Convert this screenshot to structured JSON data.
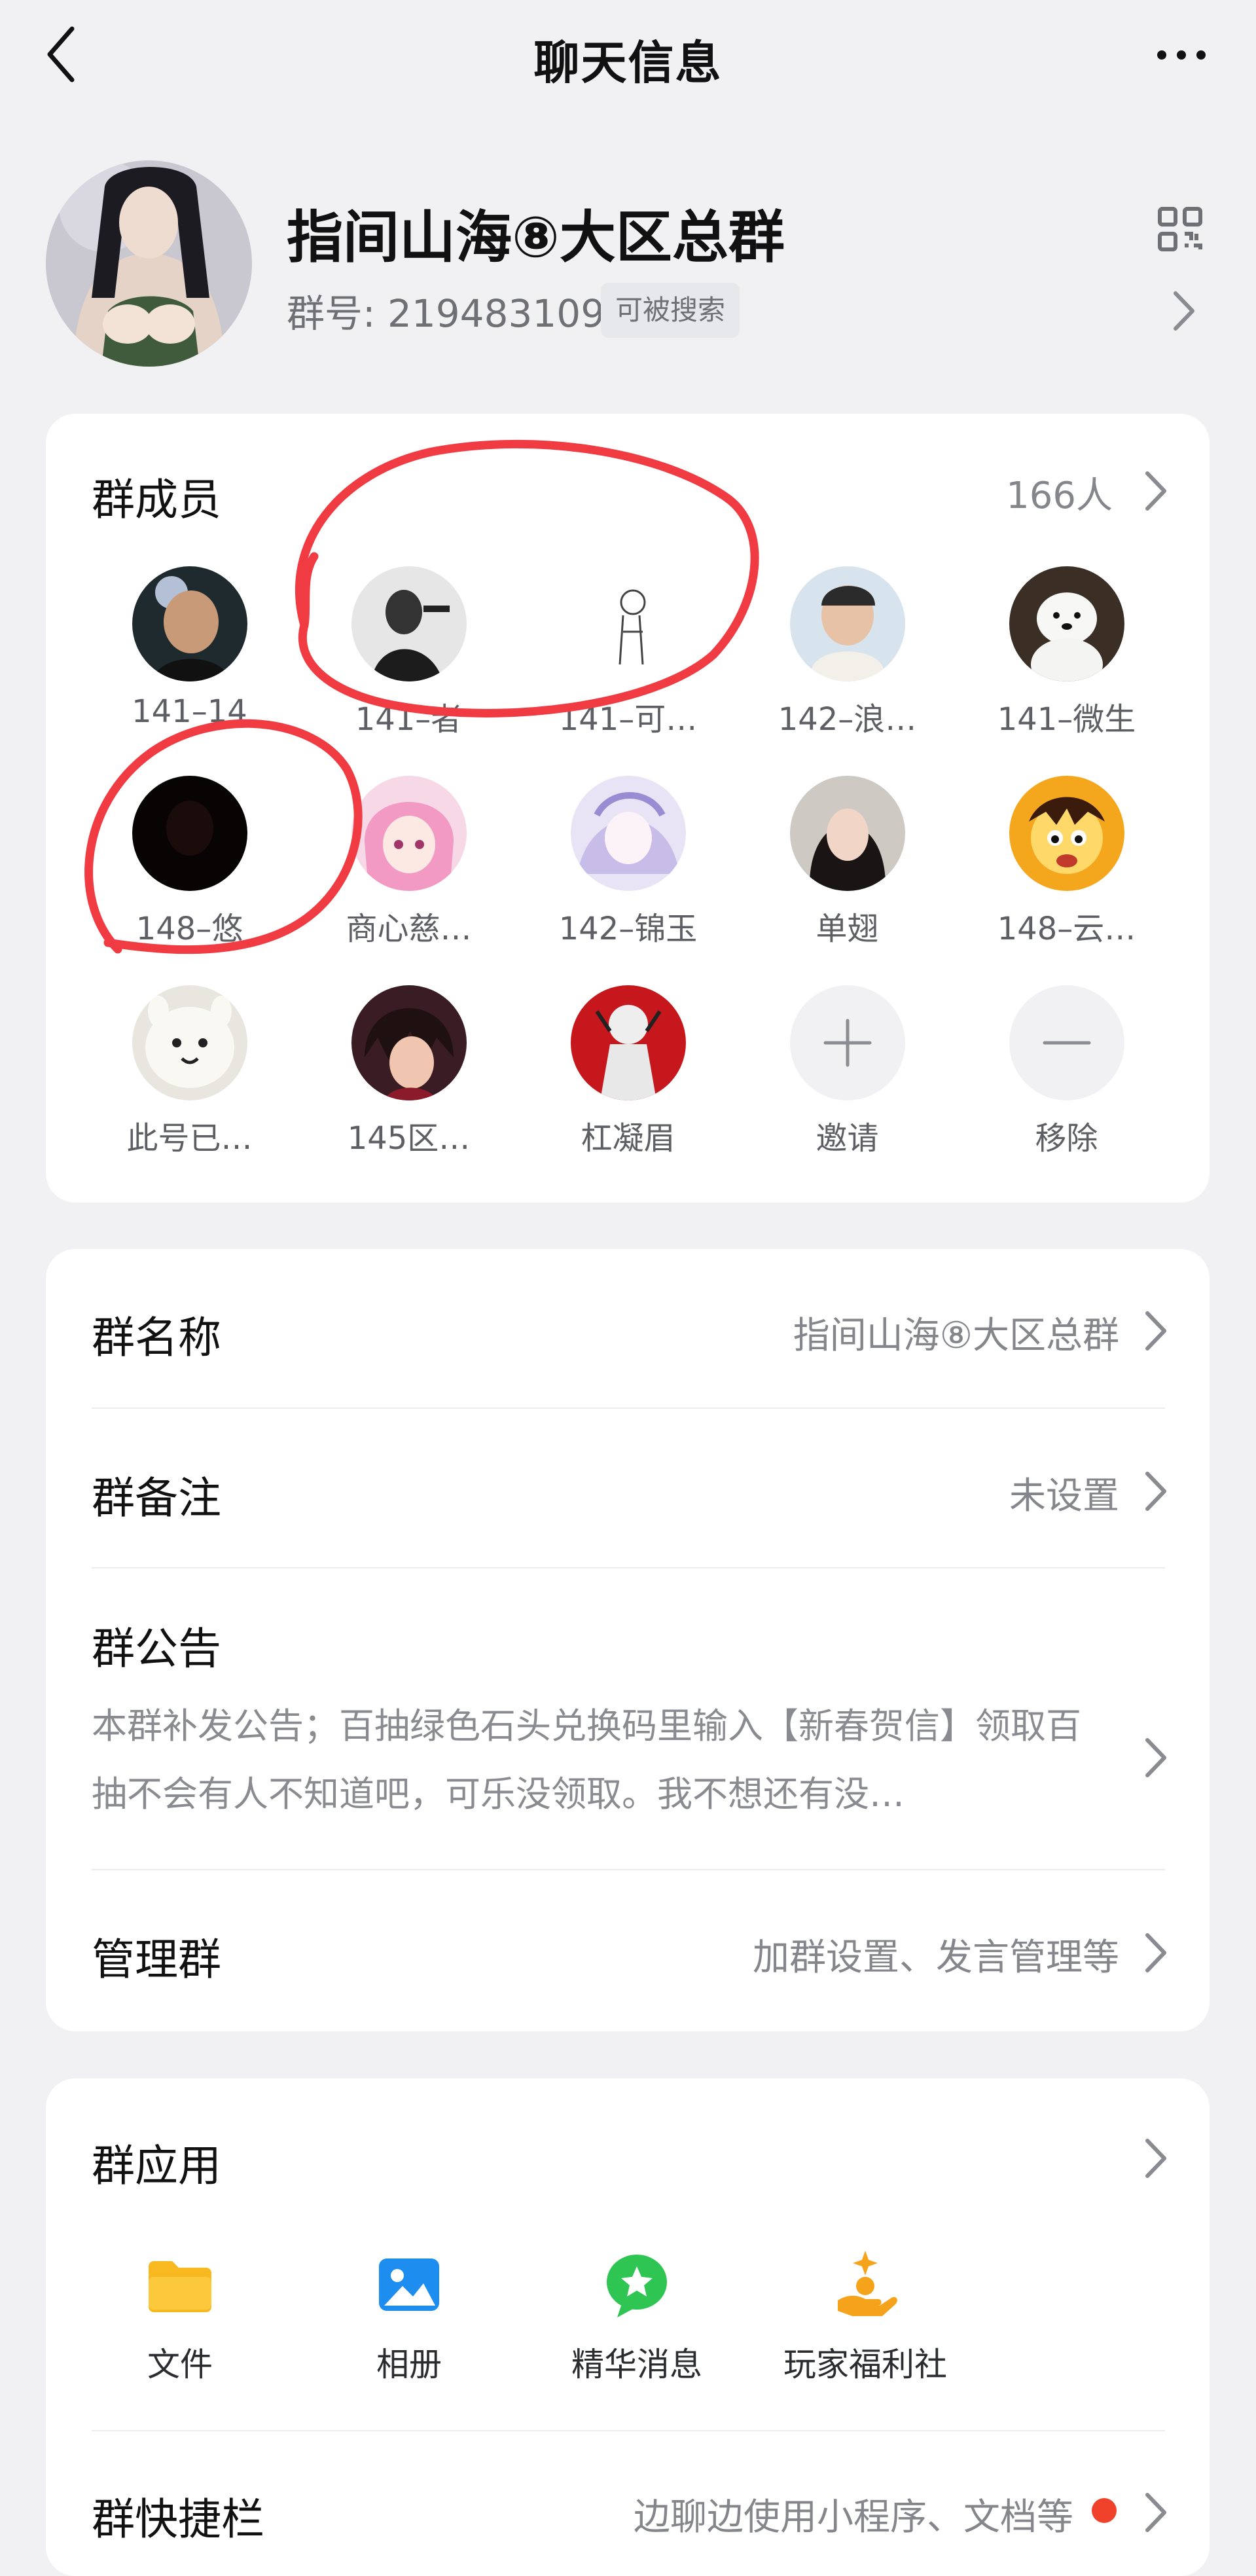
{
  "header": {
    "title": "聊天信息"
  },
  "group": {
    "name": "指间山海⑧大区总群",
    "id_text": "群号: 219483109",
    "searchable": "可被搜索"
  },
  "members": {
    "title": "群成员",
    "count": "166人",
    "list": [
      {
        "name": "141–14"
      },
      {
        "name": "141–者"
      },
      {
        "name": "141–可…"
      },
      {
        "name": "142–浪…"
      },
      {
        "name": "141–微生"
      },
      {
        "name": "148–悠"
      },
      {
        "name": "商心慈…"
      },
      {
        "name": "142–锦玉"
      },
      {
        "name": "单翅"
      },
      {
        "name": "148–云…"
      },
      {
        "name": "此号已…"
      },
      {
        "name": "145区…"
      },
      {
        "name": "杠凝眉"
      }
    ],
    "invite": "邀请",
    "remove": "移除"
  },
  "settings": {
    "group_name_label": "群名称",
    "group_name_value": "指间山海⑧大区总群",
    "remark_label": "群备注",
    "remark_value": "未设置",
    "announcement_label": "群公告",
    "announcement_text": "本群补发公告；百抽绿色石头兑换码里输入【新春贺信】领取百抽不会有人不知道吧，可乐没领取。我不想还有没…",
    "manage_label": "管理群",
    "manage_value": "加群设置、发言管理等"
  },
  "apps": {
    "title": "群应用",
    "items": [
      {
        "label": "文件",
        "icon": "folder-icon"
      },
      {
        "label": "相册",
        "icon": "photo-album-icon"
      },
      {
        "label": "精华消息",
        "icon": "star-message-icon"
      },
      {
        "label": "玩家福利社",
        "icon": "gift-hand-icon"
      }
    ],
    "shortcut_label": "群快捷栏",
    "shortcut_value": "边聊边使用小程序、文档等"
  },
  "colors": {
    "accent_red": "#f0412b",
    "annotation_red": "#ef3b41",
    "folder_yellow": "#f8b820",
    "album_blue": "#1e8df0",
    "essence_green": "#2fc552",
    "welfare_orange": "#f6a31c"
  }
}
